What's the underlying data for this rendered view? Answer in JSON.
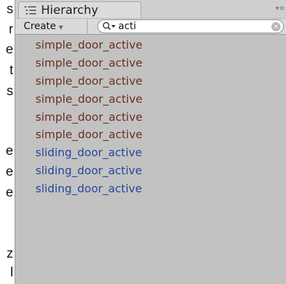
{
  "left_edge_chars": [
    "s",
    "r",
    "e",
    "t",
    "s",
    "e",
    "e",
    "e",
    "z",
    "l"
  ],
  "hierarchy": {
    "tab_title": "Hierarchy",
    "tab_icon": "list-icon",
    "menu_icon": "panel-menu-icon"
  },
  "toolbar": {
    "create_label": "Create",
    "search": {
      "value": "acti",
      "icon": "search-dropdown-icon",
      "clear_icon": "clear-icon"
    }
  },
  "colors": {
    "panel_bg": "#c2c2c2",
    "prefab_disconnected": "#6b2d22",
    "prefab_connected": "#25469c"
  },
  "results": [
    {
      "label": "simple_door_active",
      "kind": "disconnected"
    },
    {
      "label": "simple_door_active",
      "kind": "disconnected"
    },
    {
      "label": "simple_door_active",
      "kind": "disconnected"
    },
    {
      "label": "simple_door_active",
      "kind": "disconnected"
    },
    {
      "label": "simple_door_active",
      "kind": "disconnected"
    },
    {
      "label": "simple_door_active",
      "kind": "disconnected"
    },
    {
      "label": "sliding_door_active",
      "kind": "connected"
    },
    {
      "label": "sliding_door_active",
      "kind": "connected"
    },
    {
      "label": "sliding_door_active",
      "kind": "connected"
    }
  ]
}
